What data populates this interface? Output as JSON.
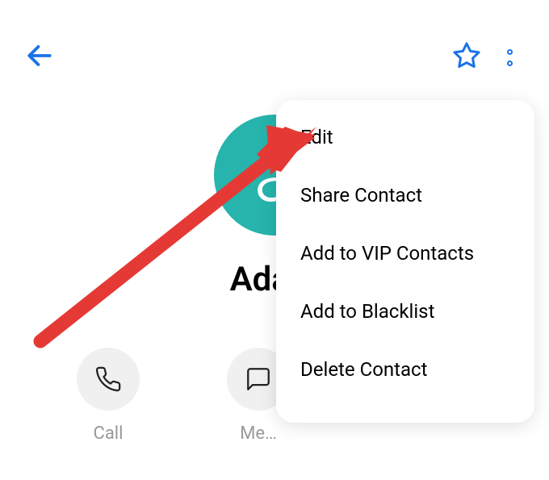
{
  "header": {
    "back_icon": "back-arrow",
    "star_icon": "star-outline",
    "more_icon": "more-vertical"
  },
  "contact": {
    "name": "Adam",
    "avatar_letter": "a"
  },
  "actions": {
    "call": {
      "label": "Call"
    },
    "message": {
      "label": "Me…"
    }
  },
  "menu": {
    "items": [
      {
        "label": "Edit"
      },
      {
        "label": "Share Contact"
      },
      {
        "label": "Add to VIP Contacts"
      },
      {
        "label": "Add to Blacklist"
      },
      {
        "label": "Delete Contact"
      }
    ]
  },
  "annotation": {
    "arrow_color": "#e53935"
  }
}
